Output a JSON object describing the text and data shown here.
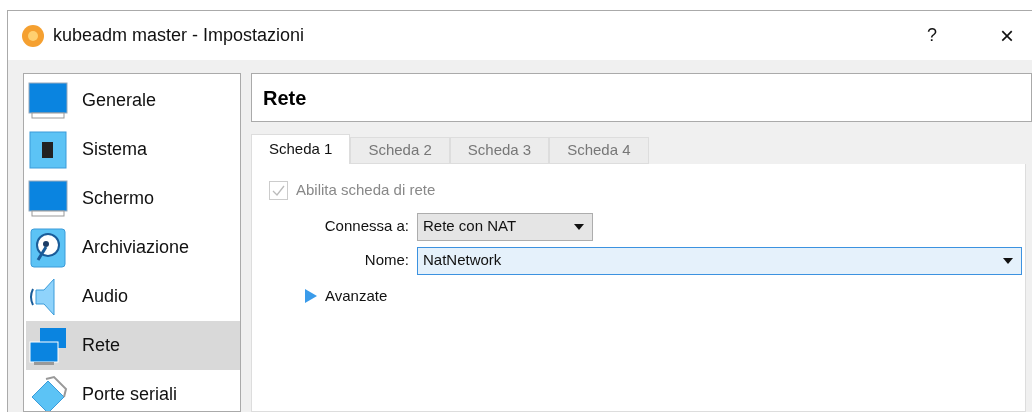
{
  "window": {
    "title": "kubeadm master - Impostazioni",
    "help": "?",
    "close": "×"
  },
  "sidebar": {
    "items": [
      {
        "label": "Generale",
        "kind": "monitor",
        "selected": false
      },
      {
        "label": "Sistema",
        "kind": "chip",
        "selected": false
      },
      {
        "label": "Schermo",
        "kind": "monitor",
        "selected": false
      },
      {
        "label": "Archiviazione",
        "kind": "disk",
        "selected": false
      },
      {
        "label": "Audio",
        "kind": "speaker",
        "selected": false
      },
      {
        "label": "Rete",
        "kind": "network",
        "selected": true
      },
      {
        "label": "Porte seriali",
        "kind": "serial",
        "selected": false
      }
    ]
  },
  "page": {
    "title": "Rete"
  },
  "tabs": [
    {
      "label": "Scheda 1",
      "selected": true
    },
    {
      "label": "Scheda 2",
      "selected": false
    },
    {
      "label": "Scheda 3",
      "selected": false
    },
    {
      "label": "Scheda 4",
      "selected": false
    }
  ],
  "adapter": {
    "enable": {
      "label": "Abilita scheda di rete",
      "checked": true,
      "disabled": true
    },
    "attached": {
      "label": "Connessa a:",
      "value": "Rete con NAT"
    },
    "name": {
      "label": "Nome:",
      "value": "NatNetwork"
    },
    "advanced": {
      "label": "Avanzate",
      "expanded": false
    }
  }
}
